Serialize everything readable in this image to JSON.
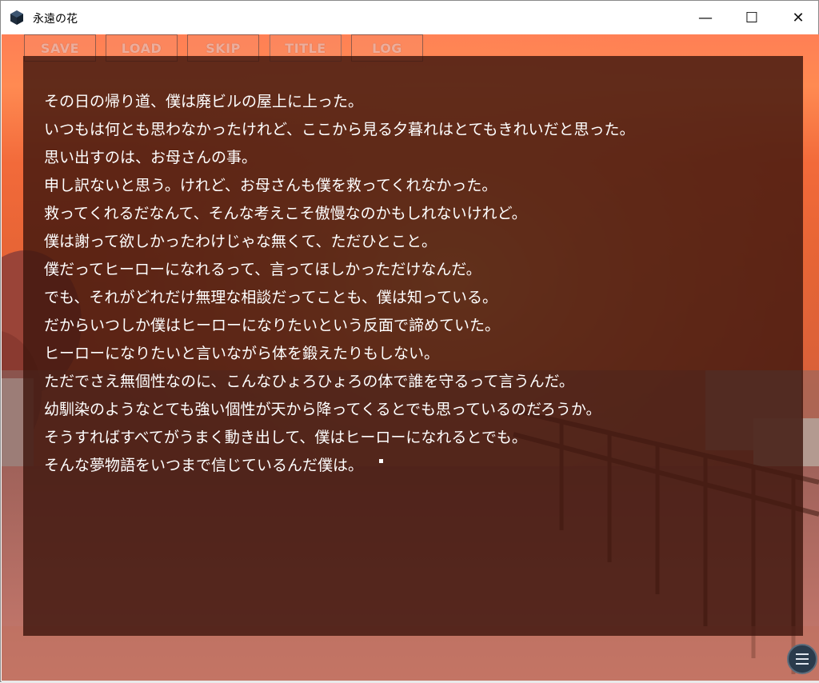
{
  "window": {
    "title": "永遠の花",
    "controls": {
      "minimize": "—",
      "maximize": "☐",
      "close": "✕"
    }
  },
  "menu": {
    "items": [
      {
        "label": "SAVE"
      },
      {
        "label": "LOAD"
      },
      {
        "label": "SKIP"
      },
      {
        "label": "TITLE"
      },
      {
        "label": "LOG"
      }
    ]
  },
  "dialogue": {
    "lines": [
      "その日の帰り道、僕は廃ビルの屋上に上った。",
      "いつもは何とも思わなかったけれど、ここから見る夕暮れはとてもきれいだと思った。",
      "思い出すのは、お母さんの事。",
      "申し訳ないと思う。けれど、お母さんも僕を救ってくれなかった。",
      "救ってくれるだなんて、そんな考えこそ傲慢なのかもしれないけれど。",
      "僕は謝って欲しかったわけじゃな無くて、ただひとこと。",
      "僕だってヒーローになれるって、言ってほしかっただけなんだ。",
      "でも、それがどれだけ無理な相談だってことも、僕は知っている。",
      "だからいつしか僕はヒーローになりたいという反面で諦めていた。",
      "ヒーローになりたいと言いながら体を鍛えたりもしない。",
      "ただでさえ無個性なのに、こんなひょろひょろの体で誰を守るって言うんだ。",
      "幼馴染のようなとても強い個性が天から降ってくるとでも思っているのだろうか。",
      "そうすればすべてがうまく動き出して、僕はヒーローになれるとでも。",
      "そんな夢物語をいつまで信じているんだ僕は。"
    ]
  },
  "icons": {
    "app": "app-cube-icon",
    "menu": "hamburger-menu-icon",
    "text_end": "text-end-cursor-icon"
  },
  "colors": {
    "panel": "#3e160e",
    "sky": "#ff7f55",
    "text": "#ffffff",
    "menu_button": "#2a3b4c"
  }
}
